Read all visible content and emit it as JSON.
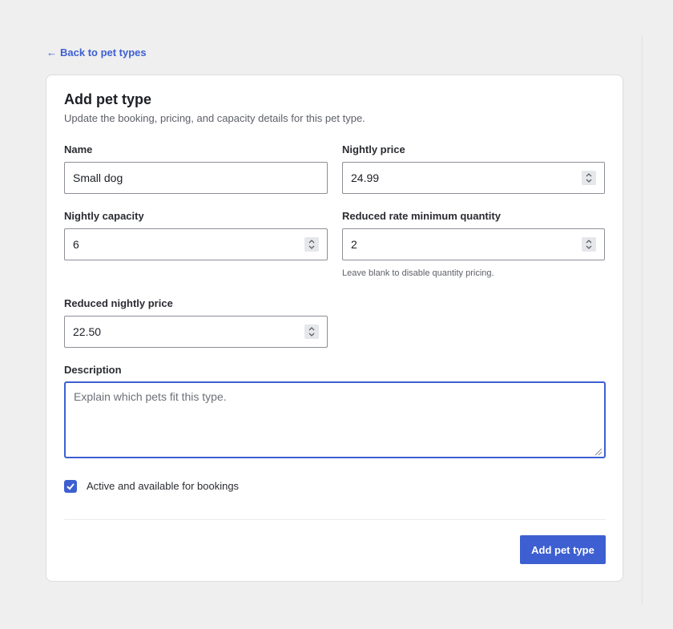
{
  "nav": {
    "back_arrow": "←",
    "back_label": "Back to pet types"
  },
  "form": {
    "title": "Add pet type",
    "subtitle": "Update the booking, pricing, and capacity details for this pet type.",
    "fields": {
      "name": {
        "label": "Name",
        "value": "Small dog"
      },
      "nightly_price": {
        "label": "Nightly price",
        "value": "24.99"
      },
      "nightly_capacity": {
        "label": "Nightly capacity",
        "value": "6"
      },
      "reduced_rate_min_qty": {
        "label": "Reduced rate minimum quantity",
        "value": "2",
        "help": "Leave blank to disable quantity pricing."
      },
      "reduced_nightly_price": {
        "label": "Reduced nightly price",
        "value": "22.50"
      },
      "description": {
        "label": "Description",
        "value": "",
        "placeholder": "Explain which pets fit this type."
      }
    },
    "active_checkbox": {
      "label": "Active and available for bookings",
      "checked": true
    },
    "submit_label": "Add pet type"
  },
  "icons": {
    "back": "arrow-left-icon",
    "spinner": "chevron-up-down-icon",
    "checkbox": "checkmark-icon",
    "resize": "resize-grip-icon"
  },
  "colors": {
    "accent": "#3d5fd1",
    "background": "#efefef",
    "card": "#ffffff",
    "border": "#8c8f96"
  }
}
